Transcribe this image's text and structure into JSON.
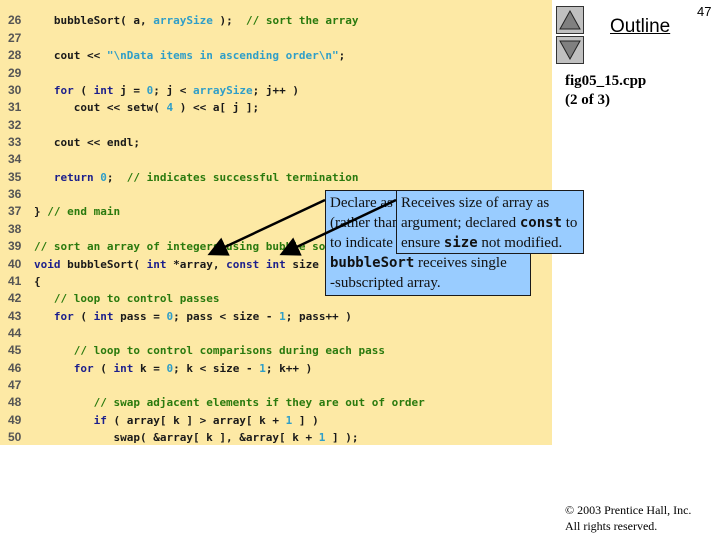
{
  "slide": {
    "page_number": "47",
    "outline_label": "Outline",
    "file_name": "fig05_15.cpp",
    "file_part": "(2 of 3)",
    "copyright_line1": "© 2003 Prentice Hall, Inc.",
    "copyright_line2": "All rights reserved.",
    "nav": {
      "up_icon": "triangle-up-icon",
      "down_icon": "triangle-down-icon"
    }
  },
  "colors": {
    "code_background": "#fde9a5",
    "keyword": "#1c1f8c",
    "identifier": "#2f9ec8",
    "comment": "#2a7a0e",
    "callout_background": "#99ccff"
  },
  "code_lines": [
    {
      "n": "26",
      "tokens": [
        [
          "p",
          "   bubbleSort( a, "
        ],
        [
          "id",
          "arraySize"
        ],
        [
          "p",
          " );  "
        ],
        [
          "cm",
          "// sort the array"
        ]
      ]
    },
    {
      "n": "27",
      "tokens": []
    },
    {
      "n": "28",
      "tokens": [
        [
          "p",
          "   cout << "
        ],
        [
          "str",
          "\"\\nData items in ascending order\\n\""
        ],
        [
          "p",
          ";"
        ]
      ]
    },
    {
      "n": "29",
      "tokens": []
    },
    {
      "n": "30",
      "tokens": [
        [
          "p",
          "   "
        ],
        [
          "kw",
          "for"
        ],
        [
          "p",
          " ( "
        ],
        [
          "kw",
          "int"
        ],
        [
          "p",
          " j = "
        ],
        [
          "num",
          "0"
        ],
        [
          "p",
          "; j < "
        ],
        [
          "id",
          "arraySize"
        ],
        [
          "p",
          "; j++ )"
        ]
      ]
    },
    {
      "n": "31",
      "tokens": [
        [
          "p",
          "      cout << setw( "
        ],
        [
          "num",
          "4"
        ],
        [
          "p",
          " ) << a[ j ];"
        ]
      ]
    },
    {
      "n": "32",
      "tokens": []
    },
    {
      "n": "33",
      "tokens": [
        [
          "p",
          "   cout << endl;"
        ]
      ]
    },
    {
      "n": "34",
      "tokens": []
    },
    {
      "n": "35",
      "tokens": [
        [
          "p",
          "   "
        ],
        [
          "kw",
          "return"
        ],
        [
          "p",
          " "
        ],
        [
          "num",
          "0"
        ],
        [
          "p",
          ";  "
        ],
        [
          "cm",
          "// indicates successful termination"
        ]
      ]
    },
    {
      "n": "36",
      "tokens": []
    },
    {
      "n": "37",
      "tokens": [
        [
          "p",
          "} "
        ],
        [
          "cm",
          "// end main"
        ]
      ]
    },
    {
      "n": "38",
      "tokens": []
    },
    {
      "n": "39",
      "tokens": [
        [
          "cm",
          "// sort an array of integers using bubble sort algorithm"
        ]
      ]
    },
    {
      "n": "40",
      "tokens": [
        [
          "kw",
          "void"
        ],
        [
          "p",
          " bubbleSort( "
        ],
        [
          "kw",
          "int"
        ],
        [
          "p",
          " *array, "
        ],
        [
          "kw",
          "const"
        ],
        [
          "p",
          " "
        ],
        [
          "kw",
          "int"
        ],
        [
          "p",
          " size )"
        ]
      ]
    },
    {
      "n": "41",
      "tokens": [
        [
          "p",
          "{"
        ]
      ]
    },
    {
      "n": "42",
      "tokens": [
        [
          "p",
          "   "
        ],
        [
          "cm",
          "// loop to control passes"
        ]
      ]
    },
    {
      "n": "43",
      "tokens": [
        [
          "p",
          "   "
        ],
        [
          "kw",
          "for"
        ],
        [
          "p",
          " ( "
        ],
        [
          "kw",
          "int"
        ],
        [
          "p",
          " pass = "
        ],
        [
          "num",
          "0"
        ],
        [
          "p",
          "; pass < size - "
        ],
        [
          "num",
          "1"
        ],
        [
          "p",
          "; pass++ )"
        ]
      ]
    },
    {
      "n": "44",
      "tokens": []
    },
    {
      "n": "45",
      "tokens": [
        [
          "p",
          "      "
        ],
        [
          "cm",
          "// loop to control comparisons during each pass"
        ]
      ]
    },
    {
      "n": "46",
      "tokens": [
        [
          "p",
          "      "
        ],
        [
          "kw",
          "for"
        ],
        [
          "p",
          " ( "
        ],
        [
          "kw",
          "int"
        ],
        [
          "p",
          " k = "
        ],
        [
          "num",
          "0"
        ],
        [
          "p",
          "; k < size - "
        ],
        [
          "num",
          "1"
        ],
        [
          "p",
          "; k++ )"
        ]
      ]
    },
    {
      "n": "47",
      "tokens": []
    },
    {
      "n": "48",
      "tokens": [
        [
          "p",
          "         "
        ],
        [
          "cm",
          "// swap adjacent elements if they are out of order"
        ]
      ]
    },
    {
      "n": "49",
      "tokens": [
        [
          "p",
          "         "
        ],
        [
          "kw",
          "if"
        ],
        [
          "p",
          " ( array[ k ] > array[ k + "
        ],
        [
          "num",
          "1"
        ],
        [
          "p",
          " ] )"
        ]
      ]
    },
    {
      "n": "50",
      "tokens": [
        [
          "p",
          "            swap( &array[ k ], &array[ k + "
        ],
        [
          "num",
          "1"
        ],
        [
          "p",
          " ] );"
        ]
      ]
    }
  ],
  "callouts": {
    "pointer": {
      "l1": "Declare as ",
      "l2": "(rather than ",
      "l3": "to indicate ",
      "l4_mono": "bubbleSort",
      "l4_rest": " receives single",
      "l5": "-subscripted array."
    },
    "size": {
      "l1": "Receives size of array as",
      "l2a": "argument; declared ",
      "l2_mono": "const",
      "l2b": " to",
      "l3a": "ensure ",
      "l3_mono": "size",
      "l3b": " not modified."
    }
  }
}
